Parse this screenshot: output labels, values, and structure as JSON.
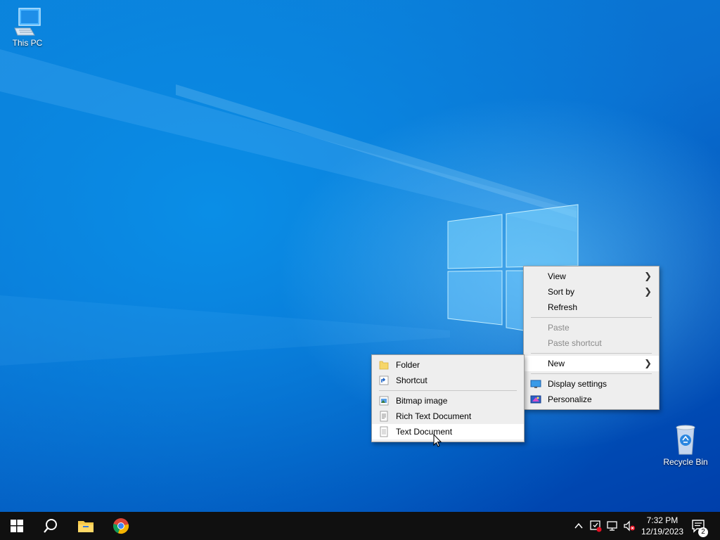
{
  "desktop": {
    "icons": [
      {
        "label": "This PC"
      },
      {
        "label": "Recycle Bin"
      }
    ]
  },
  "desktop_menu": {
    "items": [
      {
        "label": "View"
      },
      {
        "label": "Sort by"
      },
      {
        "label": "Refresh"
      },
      {
        "label": "Paste"
      },
      {
        "label": "Paste shortcut"
      },
      {
        "label": "New"
      },
      {
        "label": "Display settings"
      },
      {
        "label": "Personalize"
      }
    ]
  },
  "new_submenu": {
    "items": [
      {
        "label": "Folder"
      },
      {
        "label": "Shortcut"
      },
      {
        "label": "Bitmap image"
      },
      {
        "label": "Rich Text Document"
      },
      {
        "label": "Text Document"
      }
    ]
  },
  "taskbar": {
    "time": "7:32 PM",
    "date": "12/19/2023",
    "notification_count": "2"
  },
  "colors": {
    "accent": "#0078d7",
    "taskbar": "#101010",
    "menu_bg": "#eeeeee"
  }
}
